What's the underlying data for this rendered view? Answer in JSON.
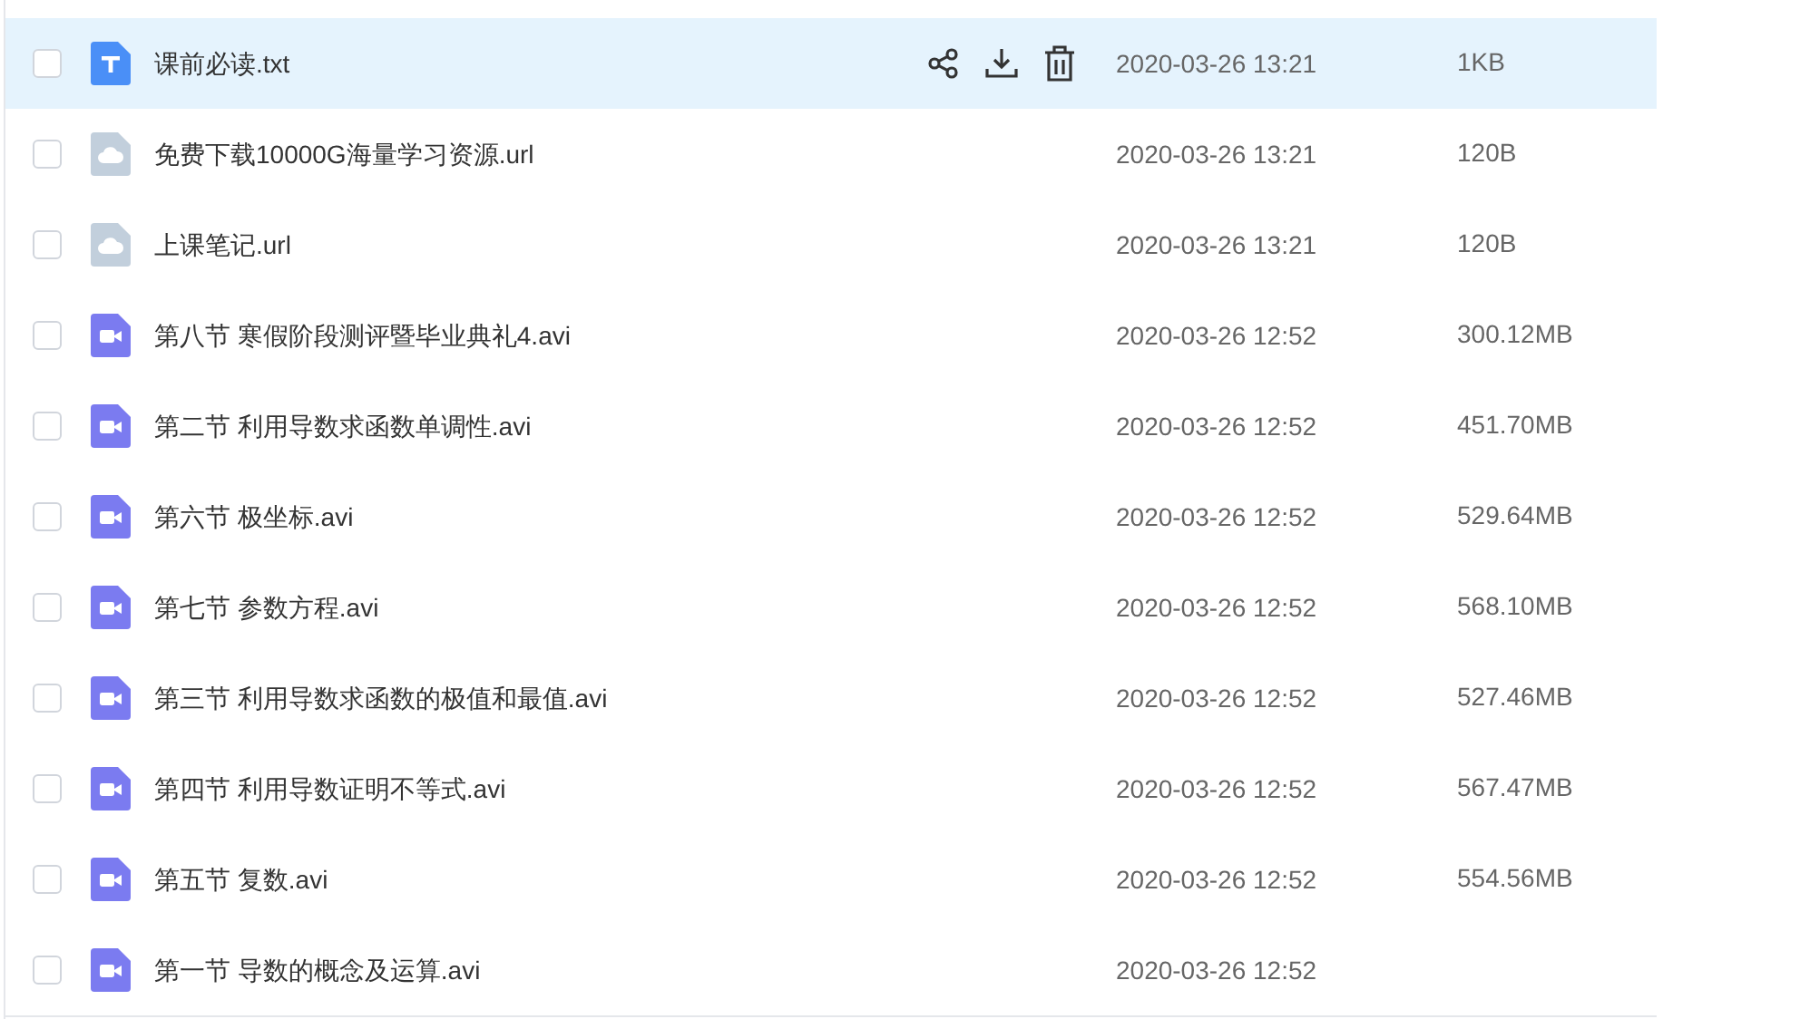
{
  "files": [
    {
      "kind": "text",
      "name": "课前必读.txt",
      "date": "2020-03-26 13:21",
      "size": "1KB",
      "checked": false,
      "highlighted": true
    },
    {
      "kind": "link",
      "name": "免费下载10000G海量学习资源.url",
      "date": "2020-03-26 13:21",
      "size": "120B",
      "checked": false,
      "highlighted": false
    },
    {
      "kind": "link",
      "name": "上课笔记.url",
      "date": "2020-03-26 13:21",
      "size": "120B",
      "checked": false,
      "highlighted": false
    },
    {
      "kind": "video",
      "name": "第八节 寒假阶段测评暨毕业典礼4.avi",
      "date": "2020-03-26 12:52",
      "size": "300.12MB",
      "checked": false,
      "highlighted": false
    },
    {
      "kind": "video",
      "name": "第二节 利用导数求函数单调性.avi",
      "date": "2020-03-26 12:52",
      "size": "451.70MB",
      "checked": false,
      "highlighted": false
    },
    {
      "kind": "video",
      "name": "第六节 极坐标.avi",
      "date": "2020-03-26 12:52",
      "size": "529.64MB",
      "checked": false,
      "highlighted": false
    },
    {
      "kind": "video",
      "name": "第七节 参数方程.avi",
      "date": "2020-03-26 12:52",
      "size": "568.10MB",
      "checked": false,
      "highlighted": false
    },
    {
      "kind": "video",
      "name": "第三节 利用导数求函数的极值和最值.avi",
      "date": "2020-03-26 12:52",
      "size": "527.46MB",
      "checked": false,
      "highlighted": false
    },
    {
      "kind": "video",
      "name": "第四节 利用导数证明不等式.avi",
      "date": "2020-03-26 12:52",
      "size": "567.47MB",
      "checked": false,
      "highlighted": false
    },
    {
      "kind": "video",
      "name": "第五节 复数.avi",
      "date": "2020-03-26 12:52",
      "size": "554.56MB",
      "checked": false,
      "highlighted": false
    },
    {
      "kind": "video",
      "name": "第一节 导数的概念及运算.avi",
      "date": "2020-03-26 12:52",
      "checked": false,
      "highlighted": false
    }
  ]
}
